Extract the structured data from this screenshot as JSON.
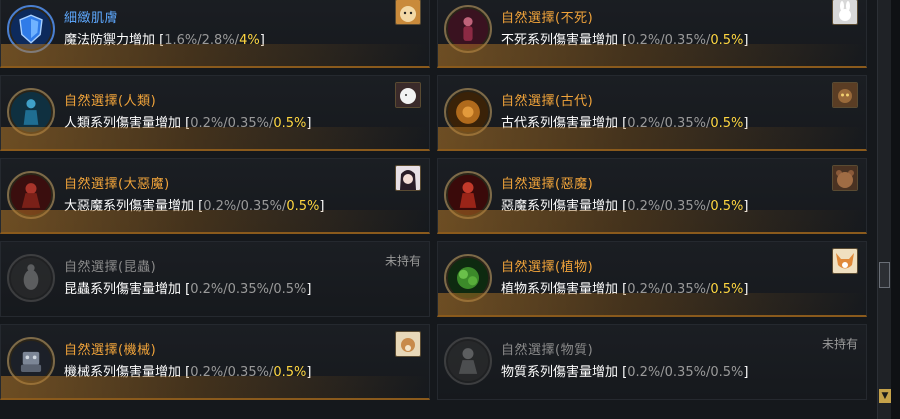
{
  "cards": [
    {
      "title": "細緻肌膚",
      "title_style": "blue",
      "desc_prefix": "魔法防禦力增加 [",
      "v1": "1.6%",
      "v2": "2.8%",
      "v3": "4%",
      "suffix": "]",
      "owned": true,
      "portrait": "hamster-portrait",
      "skill_icon": "shield-icon"
    },
    {
      "title": "自然選擇(不死)",
      "title_style": "orange",
      "desc_prefix": "不死系列傷害量增加 [",
      "v1": "0.2%",
      "v2": "0.35%",
      "v3": "0.5%",
      "suffix": "]",
      "owned": true,
      "portrait": "rabbit-portrait",
      "skill_icon": "undead-icon"
    },
    {
      "title": "自然選擇(人類)",
      "title_style": "orange",
      "desc_prefix": "人類系列傷害量增加 [",
      "v1": "0.2%",
      "v2": "0.35%",
      "v3": "0.5%",
      "suffix": "]",
      "owned": true,
      "portrait": "white-pet-portrait",
      "skill_icon": "human-icon"
    },
    {
      "title": "自然選擇(古代)",
      "title_style": "orange",
      "desc_prefix": "古代系列傷害量增加 [",
      "v1": "0.2%",
      "v2": "0.35%",
      "v3": "0.5%",
      "suffix": "]",
      "owned": true,
      "portrait": "owl-portrait",
      "skill_icon": "ancient-icon"
    },
    {
      "title": "自然選擇(大惡魔)",
      "title_style": "orange",
      "desc_prefix": "大惡魔系列傷害量增加 [",
      "v1": "0.2%",
      "v2": "0.35%",
      "v3": "0.5%",
      "suffix": "]",
      "owned": true,
      "portrait": "girl-portrait",
      "skill_icon": "archdemon-icon"
    },
    {
      "title": "自然選擇(惡魔)",
      "title_style": "orange",
      "desc_prefix": "惡魔系列傷害量增加 [",
      "v1": "0.2%",
      "v2": "0.35%",
      "v3": "0.5%",
      "suffix": "]",
      "owned": true,
      "portrait": "bear-portrait",
      "skill_icon": "demon-icon"
    },
    {
      "title": "自然選擇(昆蟲)",
      "title_style": "grey",
      "desc_prefix": "昆蟲系列傷害量增加 [",
      "v1": "0.2%",
      "v2": "0.35%",
      "v3": "0.5%",
      "suffix": "]",
      "owned": false,
      "not_owned_label": "未持有",
      "skill_icon": "insect-icon"
    },
    {
      "title": "自然選擇(植物)",
      "title_style": "orange",
      "desc_prefix": "植物系列傷害量增加 [",
      "v1": "0.2%",
      "v2": "0.35%",
      "v3": "0.5%",
      "suffix": "]",
      "owned": true,
      "portrait": "fox-portrait",
      "skill_icon": "plant-icon"
    },
    {
      "title": "自然選擇(機械)",
      "title_style": "orange",
      "desc_prefix": "機械系列傷害量增加 [",
      "v1": "0.2%",
      "v2": "0.35%",
      "v3": "0.5%",
      "suffix": "]",
      "owned": true,
      "portrait": "squirrel-portrait",
      "skill_icon": "machine-icon"
    },
    {
      "title": "自然選擇(物質)",
      "title_style": "grey",
      "desc_prefix": "物質系列傷害量增加 [",
      "v1": "0.2%",
      "v2": "0.35%",
      "v3": "0.5%",
      "suffix": "]",
      "owned": false,
      "not_owned_label": "未持有",
      "skill_icon": "matter-icon"
    }
  ],
  "colors": {
    "orange": "#f0a33a",
    "blue": "#5ea9ff",
    "yellow": "#ffd640",
    "grey": "#9a9a9a"
  }
}
